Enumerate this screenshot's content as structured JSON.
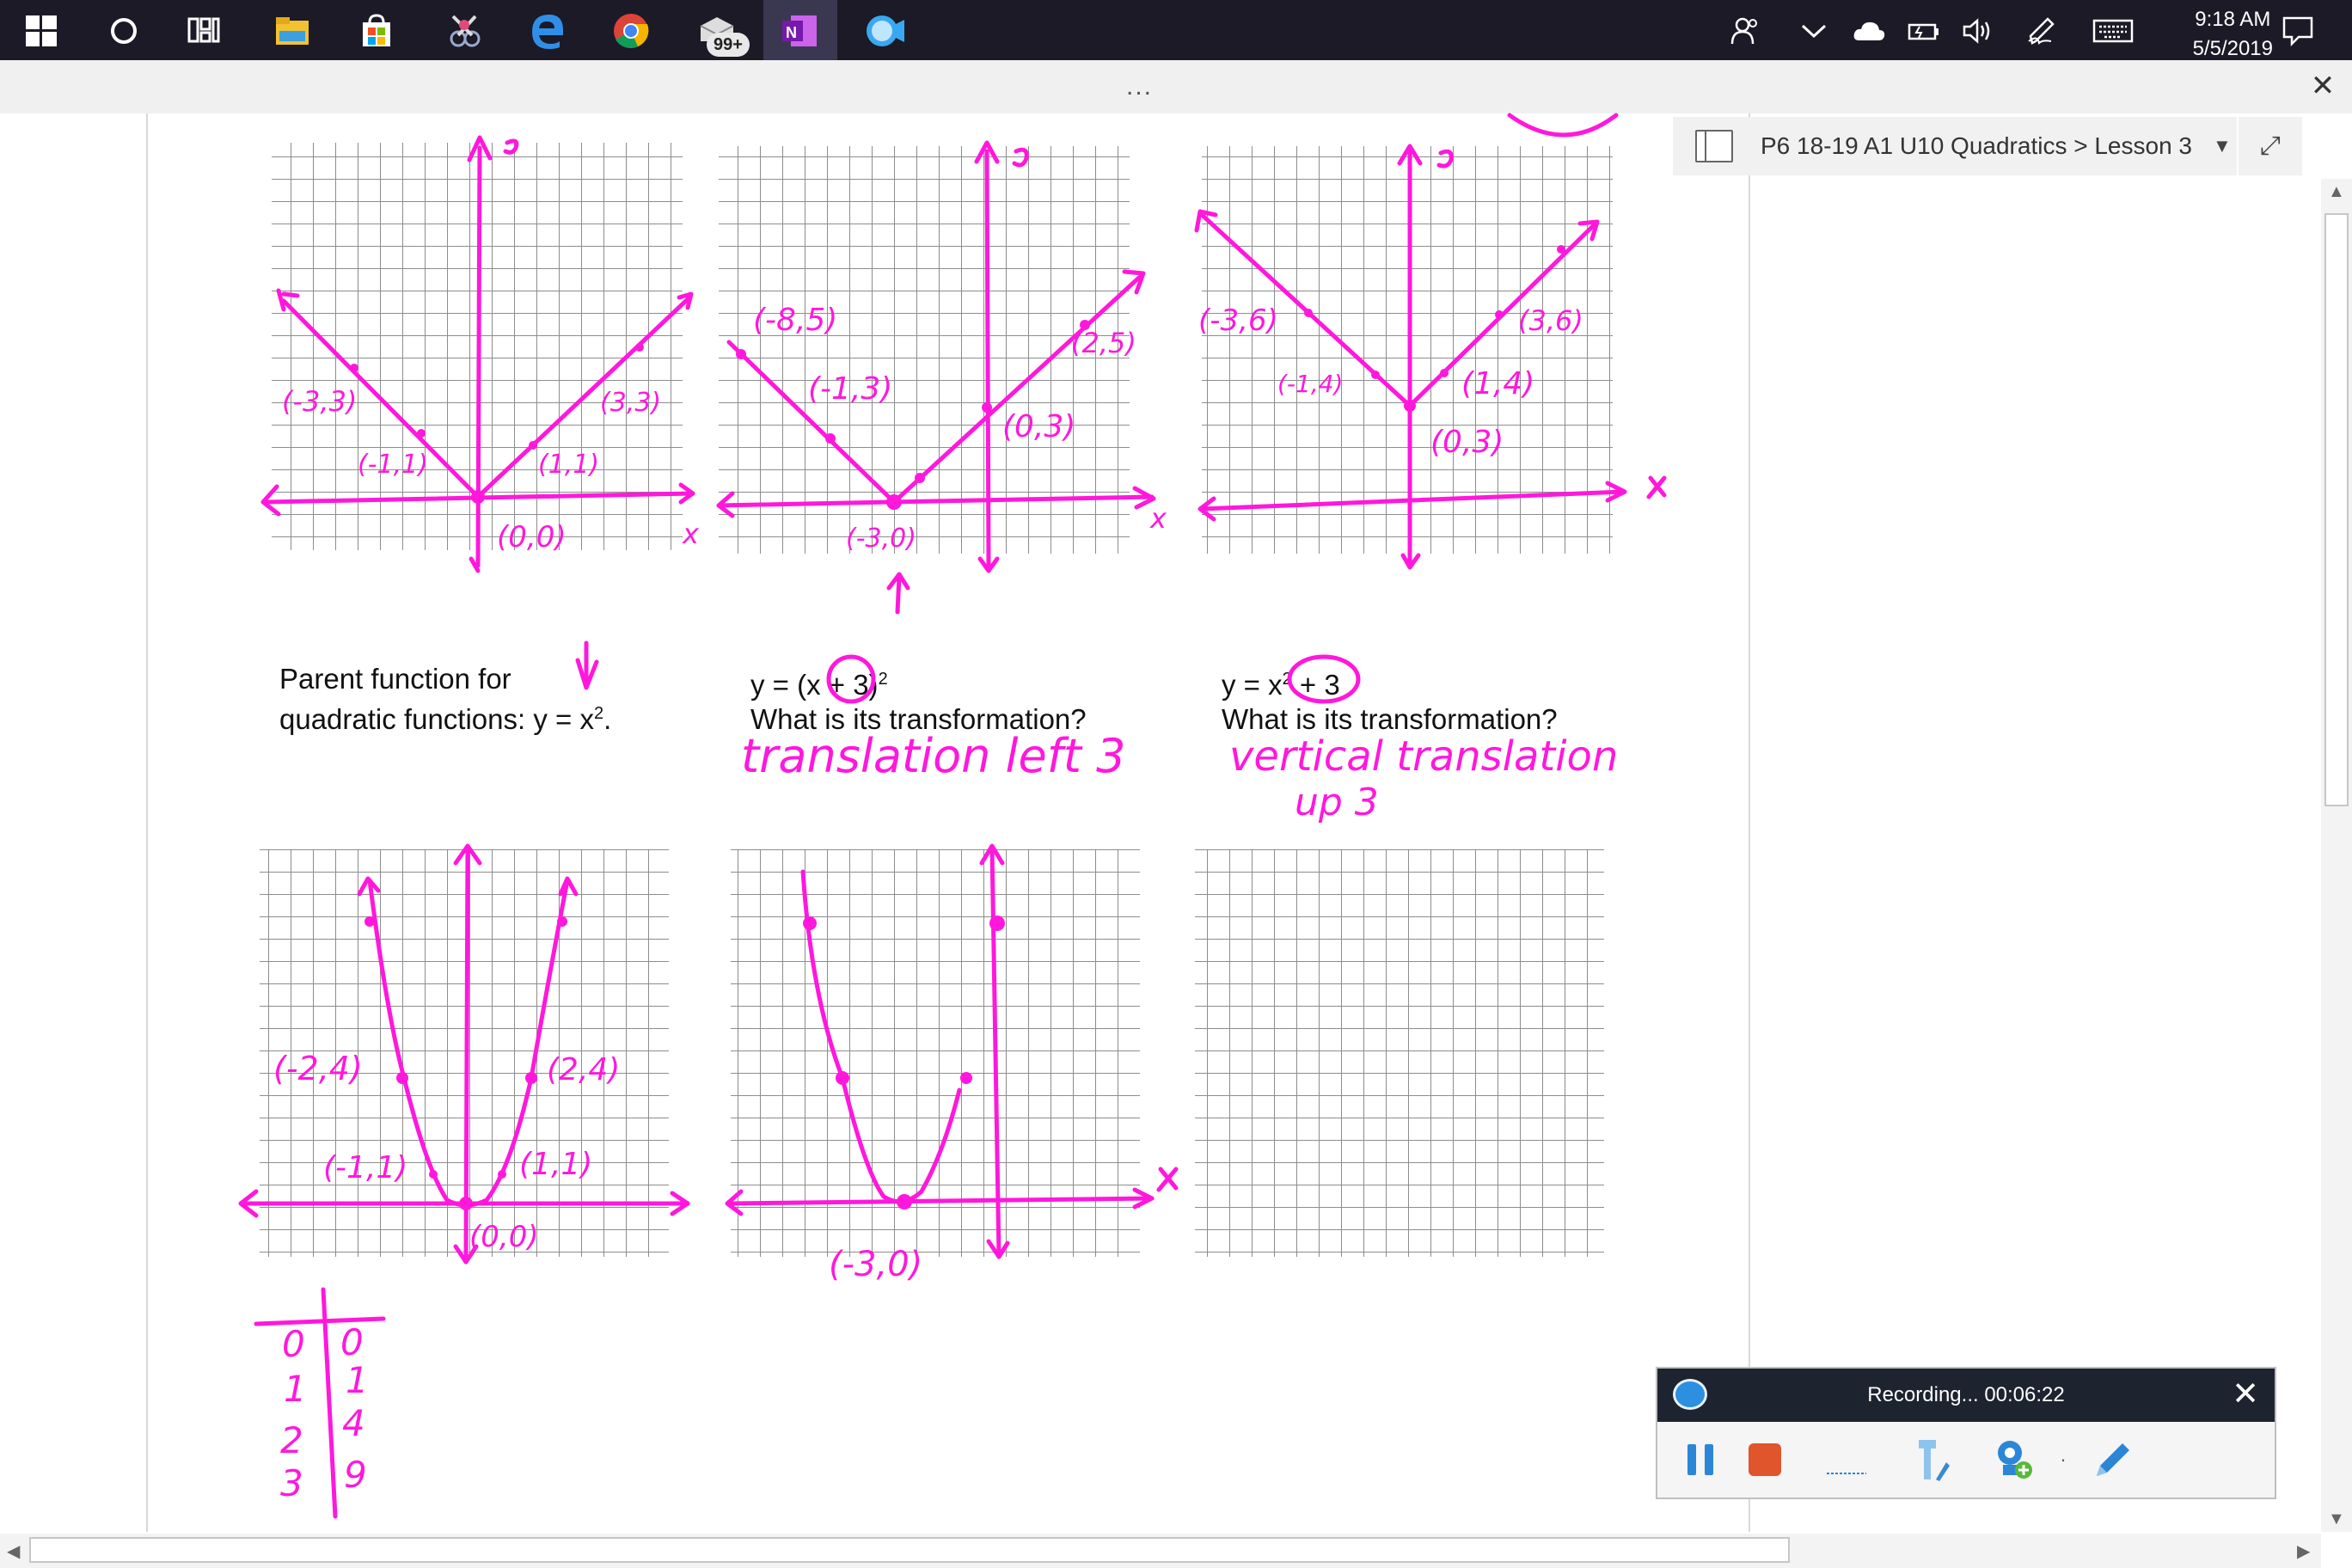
{
  "taskbar": {
    "apps": [
      "start",
      "cortana",
      "task-view",
      "file-explorer",
      "store",
      "snipping-tool",
      "edge",
      "chrome",
      "mail",
      "onenote",
      "screencast"
    ],
    "mail_badge": "99+",
    "time": "9:18 AM",
    "date": "5/5/2019"
  },
  "window": {
    "more_dots": "...",
    "close_symbol": "✕"
  },
  "notebook": {
    "breadcrumb": "P6 18-19 A1 U10 Quadratics > Lesson 3",
    "caret": "▼",
    "expand_symbol": "⤢"
  },
  "page": {
    "parent_line1": "Parent function for",
    "parent_line2_a": "quadratic functions:  y = x",
    "parent_line2_sup": "2",
    "parent_line2_b": ".",
    "q1_a": "y = (x + 3)",
    "q1_sup": "2",
    "q1_question": "What is its transformation?",
    "q2_a": "y = x",
    "q2_sup": "2",
    "q2_b": " + 3",
    "q2_question": "What is its transformation?"
  },
  "ink": {
    "answer1": "translation left 3",
    "answer2_line1": "vertical translation",
    "answer2_line2": "up 3",
    "g1_labels": [
      "(-3,3)",
      "(-1,1)",
      "(1,1)",
      "(3,3)",
      "(0,0)"
    ],
    "g2_labels": [
      "(-8,5)",
      "(-1,3)",
      "(2,5)",
      "(0,3)",
      "(-3,0)"
    ],
    "g3_labels": [
      "(-3,6)",
      "(-1,4)",
      "(3,6)",
      "(1,4)",
      "(0,3)"
    ],
    "g4_labels": [
      "(-2,4)",
      "(2,4)",
      "(-1,1)",
      "(1,1)",
      "(0,0)"
    ],
    "g5_labels": [
      "(-3,0)"
    ],
    "axis_x": "x",
    "axis_y": "y",
    "table_x": [
      "0",
      "1",
      "2",
      "3"
    ],
    "table_y": [
      "0",
      "1",
      "4",
      "9"
    ]
  },
  "recorder": {
    "status": "Recording... 00:06:22",
    "close_symbol": "✕"
  },
  "colors": {
    "ink": "#ff18dc",
    "taskbar": "#1c1a26",
    "recorder_header": "#1e2330",
    "stop": "#e0552c",
    "pause": "#2b86d8"
  }
}
